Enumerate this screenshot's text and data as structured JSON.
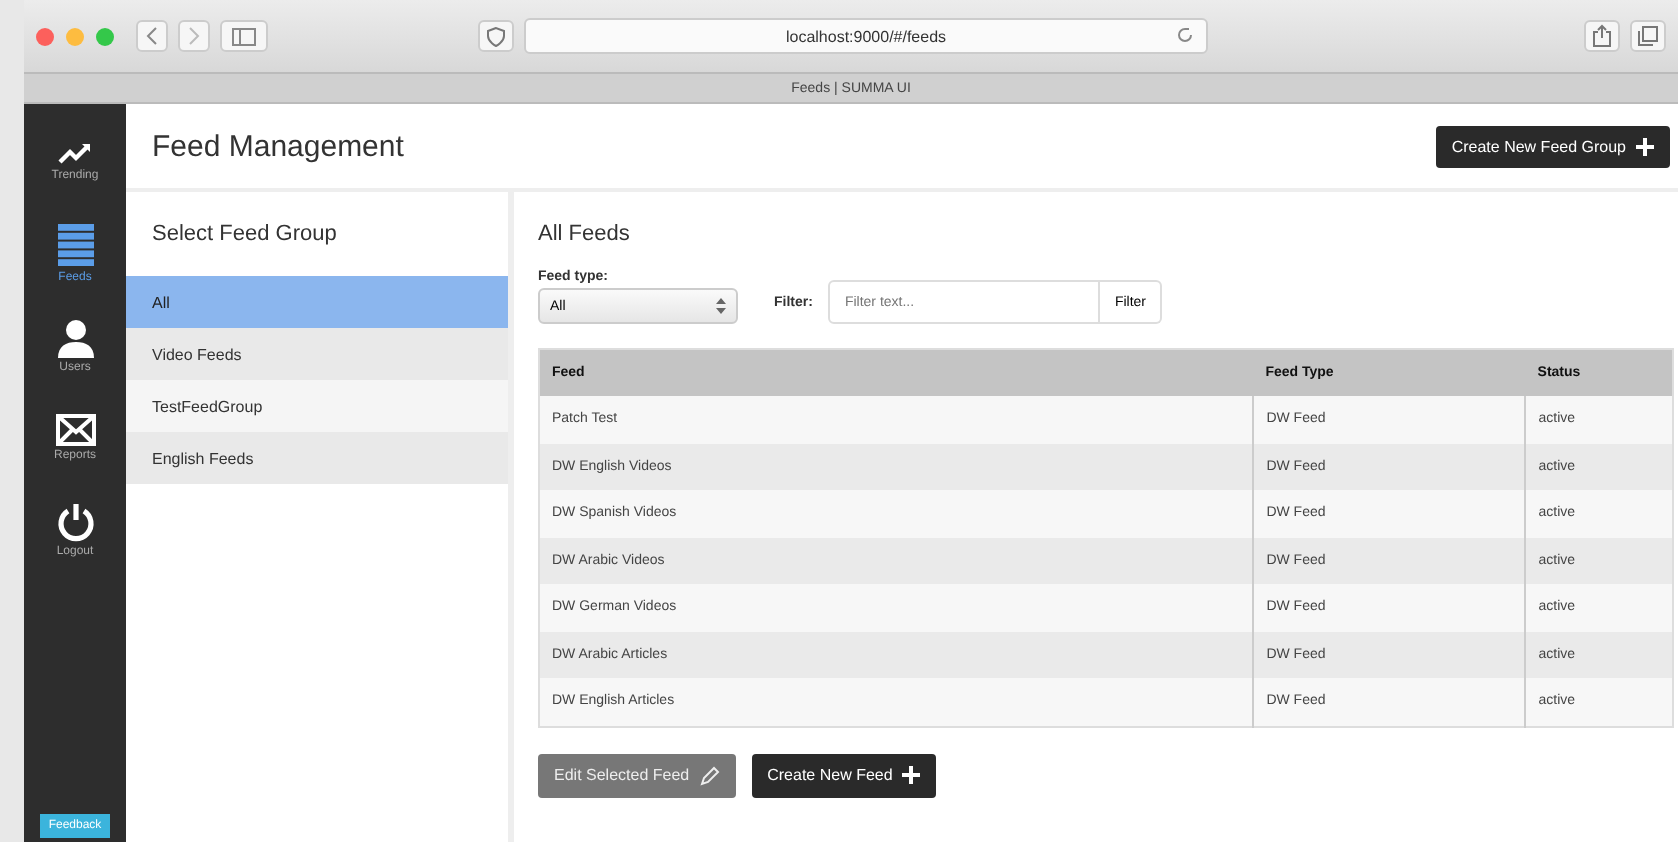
{
  "browser": {
    "url": "localhost:9000/#/feeds",
    "tab_title": "Feeds | SUMMA UI"
  },
  "nav": [
    {
      "label": "Trending",
      "kind": "trend",
      "selected": false
    },
    {
      "label": "Feeds",
      "kind": "list",
      "selected": true
    },
    {
      "label": "Users",
      "kind": "user",
      "selected": false
    },
    {
      "label": "Reports",
      "kind": "mail",
      "selected": false
    },
    {
      "label": "Logout",
      "kind": "power",
      "selected": false
    }
  ],
  "feedback_button": "Feedback",
  "header": {
    "title": "Feed Management",
    "button": "Create New Feed Group"
  },
  "groups": {
    "title": "Select Feed Group",
    "items": [
      {
        "label": "All",
        "selected": true
      },
      {
        "label": "Video Feeds",
        "selected": false
      },
      {
        "label": "TestFeedGroup",
        "selected": false
      },
      {
        "label": "English Feeds",
        "selected": false
      }
    ]
  },
  "feeds": {
    "title": "All Feeds",
    "type_label": "Feed type:",
    "type_value": "All",
    "filter_label": "Filter:",
    "filter_placeholder": "Filter text...",
    "filter_button": "Filter",
    "columns": [
      "Feed",
      "Feed Type",
      "Status"
    ],
    "rows": [
      [
        "Patch Test",
        "DW Feed",
        "active"
      ],
      [
        "DW English Videos",
        "DW Feed",
        "active"
      ],
      [
        "DW Spanish Videos",
        "DW Feed",
        "active"
      ],
      [
        "DW Arabic Videos",
        "DW Feed",
        "active"
      ],
      [
        "DW German Videos",
        "DW Feed",
        "active"
      ],
      [
        "DW Arabic Articles",
        "DW Feed",
        "active"
      ],
      [
        "DW English Articles",
        "DW Feed",
        "active"
      ]
    ],
    "edit_button": {
      "label": "Edit Selected Feed",
      "disabled": true
    },
    "create_button": "Create New Feed"
  }
}
